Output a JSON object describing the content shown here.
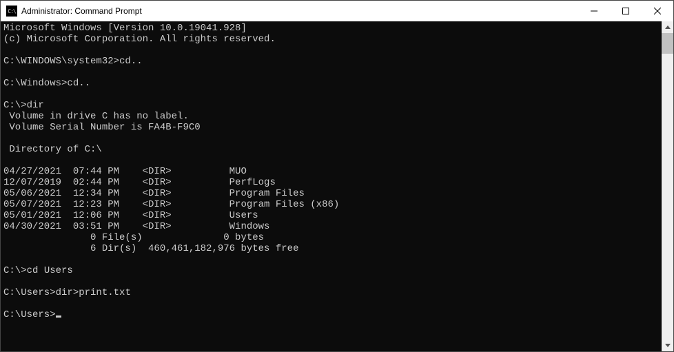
{
  "titlebar": {
    "icon_text": "C:\\",
    "title": "Administrator: Command Prompt"
  },
  "terminal": {
    "header1": "Microsoft Windows [Version 10.0.19041.928]",
    "header2": "(c) Microsoft Corporation. All rights reserved.",
    "blank": "",
    "p1_prompt": "C:\\WINDOWS\\system32>",
    "p1_cmd": "cd..",
    "p2_prompt": "C:\\Windows>",
    "p2_cmd": "cd..",
    "p3_prompt": "C:\\>",
    "p3_cmd": "dir",
    "vol1": " Volume in drive C has no label.",
    "vol2": " Volume Serial Number is FA4B-F9C0",
    "dir_of": " Directory of C:\\",
    "rows": [
      "04/27/2021  07:44 PM    <DIR>          MUO",
      "12/07/2019  02:44 PM    <DIR>          PerfLogs",
      "05/06/2021  12:34 PM    <DIR>          Program Files",
      "05/07/2021  12:23 PM    <DIR>          Program Files (x86)",
      "05/01/2021  12:06 PM    <DIR>          Users",
      "04/30/2021  03:51 PM    <DIR>          Windows"
    ],
    "sum1": "               0 File(s)              0 bytes",
    "sum2": "               6 Dir(s)  460,461,182,976 bytes free",
    "p4_prompt": "C:\\>",
    "p4_cmd": "cd Users",
    "p5_prompt": "C:\\Users>",
    "p5_cmd": "dir>print.txt",
    "p6_prompt": "C:\\Users>"
  }
}
